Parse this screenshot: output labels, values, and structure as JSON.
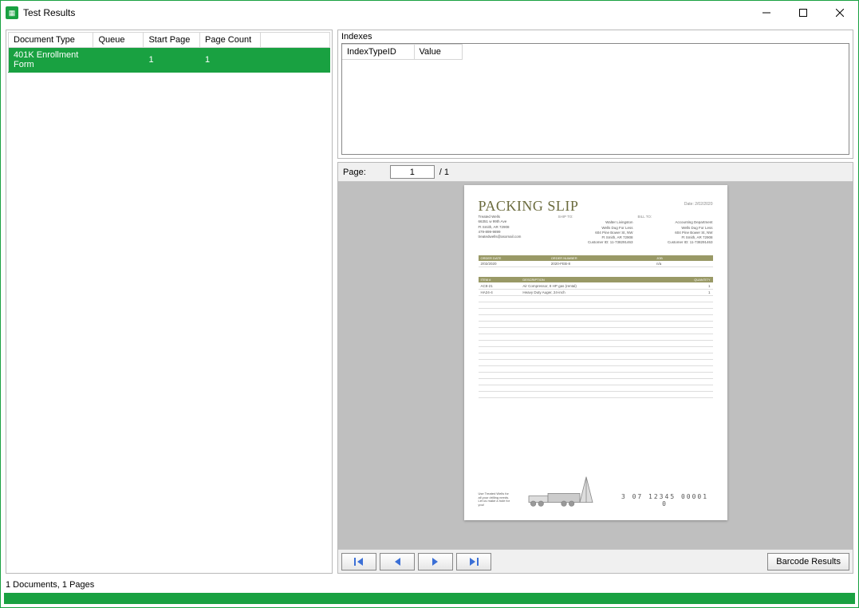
{
  "window": {
    "title": "Test Results"
  },
  "doc_table": {
    "headers": [
      "Document Type",
      "Queue",
      "Start Page",
      "Page Count"
    ],
    "rows": [
      {
        "doctype": "401K Enrollment Form",
        "queue": "",
        "start": "1",
        "pagecount": "1"
      }
    ]
  },
  "indexes": {
    "label": "Indexes",
    "headers": [
      "IndexTypeID",
      "Value"
    ]
  },
  "viewer": {
    "page_label": "Page:",
    "page_value": "1",
    "page_total": "/ 1",
    "barcode_results": "Barcode Results"
  },
  "doc": {
    "title": "PACKING SLIP",
    "date_label": "Date: 2/02/2020",
    "from": {
      "name": "Treated Wells",
      "line1": "66351 w 99th Ave",
      "line2": "Ft Smith, AR 72908",
      "phone": "479-899-9899",
      "email": "treatedwells@asomail.com"
    },
    "shipto_label": "SHIP TO:",
    "shipto": {
      "name": "Walter Livingston",
      "line1": "Wells Dug For Less",
      "line2": "604 Pine Bower St, NW",
      "line3": "Ft Smith, AR 72908",
      "cust": "Customer ID: 11-738291463"
    },
    "billto_label": "BILL TO:",
    "billto": {
      "name": "Accounting Department",
      "line1": "Wells Dug For Less",
      "line2": "604 Pine Bower St, NW",
      "line3": "Ft Smith, AR 72908",
      "cust": "Customer ID: 11-738291463"
    },
    "order_headers": [
      "ORDER DATE",
      "ORDER NUMBER",
      "JOB"
    ],
    "order_row": [
      "2/02/2020",
      "2020-FEB-8",
      "n/a"
    ],
    "item_headers": [
      "ITEM #",
      "DESCRIPTION",
      "QUANTITY"
    ],
    "items": [
      {
        "num": "AC8-21",
        "desc": "Air Compressor, 8 HP gas (rental)",
        "qty": "1"
      },
      {
        "num": "HA24-4",
        "desc": "Heavy Duty Auger, 24-inch",
        "qty": "1"
      }
    ],
    "motto": "Use Treated Wells for all your drilling needs. Let us make a hole for you!",
    "barcode_text": "3 07 12345 00001 0"
  },
  "status": "1 Documents, 1 Pages"
}
